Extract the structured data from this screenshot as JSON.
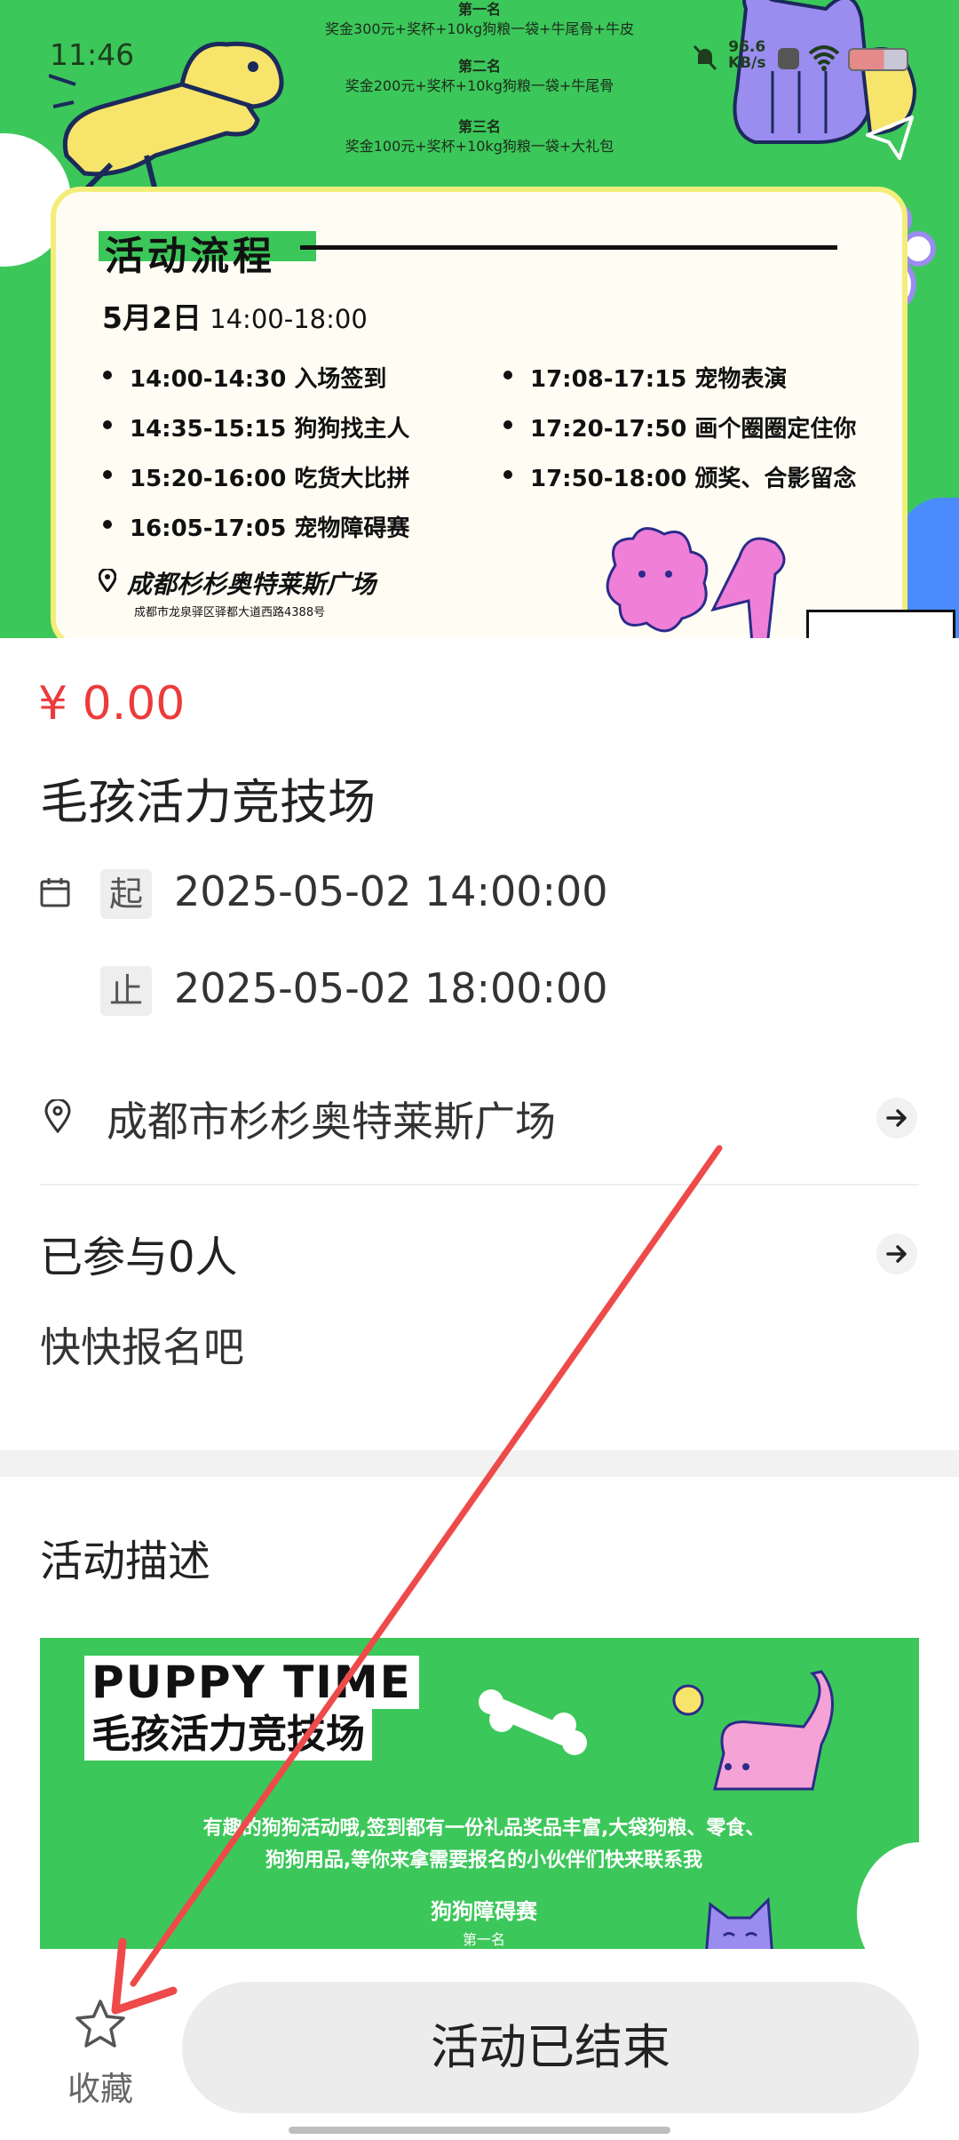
{
  "status_bar": {
    "time": "11:46",
    "net_speed_value": "96.6",
    "net_speed_unit": "KB/s"
  },
  "banner": {
    "prizes": [
      {
        "place": "第一名",
        "detail": "奖金300元+奖杯+10kg狗粮一袋+牛尾骨+牛皮"
      },
      {
        "place": "第二名",
        "detail": "奖金200元+奖杯+10kg狗粮一袋+牛尾骨"
      },
      {
        "place": "第三名",
        "detail": "奖金100元+奖杯+10kg狗粮一袋+大礼包"
      }
    ],
    "flow_title": "活动流程",
    "date_bold": "5月2日",
    "date_time": "14:00-18:00",
    "schedule_left": [
      "14:00-14:30 入场签到",
      "14:35-15:15 狗狗找主人",
      "15:20-16:00 吃货大比拼",
      "16:05-17:05 宠物障碍赛"
    ],
    "schedule_right": [
      "17:08-17:15 宠物表演",
      "17:20-17:50 画个圈圈定住你",
      "17:50-18:00 颁奖、合影留念"
    ],
    "venue": "成都杉杉奥特莱斯广场",
    "venue_address": "成都市龙泉驿区驿都大道西路4388号"
  },
  "event": {
    "price": "¥ 0.00",
    "title": "毛孩活力竞技场",
    "start_tag": "起",
    "start_time": "2025-05-02 14:00:00",
    "end_tag": "止",
    "end_time": "2025-05-02 18:00:00",
    "location": "成都市杉杉奥特莱斯广场",
    "joined": "已参与0人",
    "hurry": "快快报名吧",
    "description_title": "活动描述"
  },
  "description_image": {
    "headline_en": "PUPPY TIME",
    "headline_cn": "毛孩活力竞技场",
    "line1": "有趣的狗狗活动哦,签到都有一份礼品奖品丰富,大袋狗粮、零食、",
    "line2": "狗狗用品,等你来拿需要报名的小伙伴们快来联系我",
    "sub": "狗狗障碍赛",
    "first": "第一名"
  },
  "bottom_bar": {
    "favorite_label": "收藏",
    "status_button": "活动已结束"
  },
  "colors": {
    "banner_green": "#3cc75a",
    "price_red": "#ec3b3b",
    "annotation_arrow": "#ee4a4a"
  },
  "icons": [
    "calendar-icon",
    "location-pin-icon",
    "arrow-right-icon",
    "star-icon",
    "mute-icon",
    "wifi-icon",
    "battery-icon",
    "send-icon"
  ]
}
